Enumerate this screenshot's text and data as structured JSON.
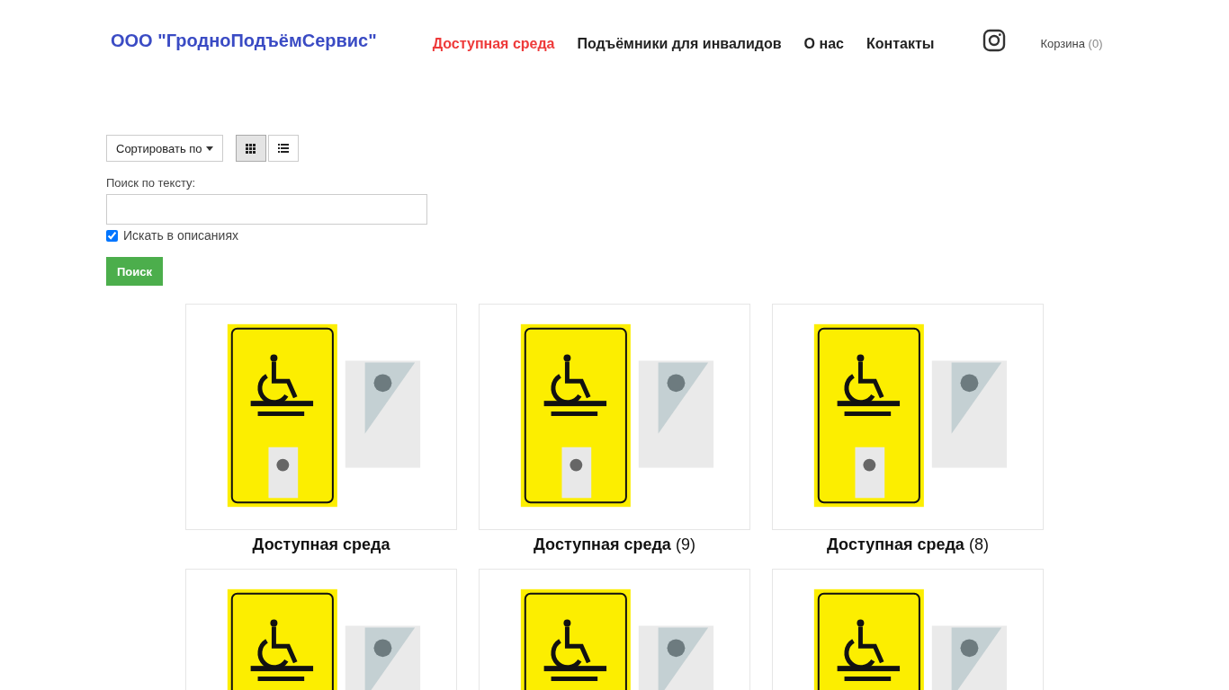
{
  "logo": "ООО \"ГродноПодъёмСервис\"",
  "nav": [
    {
      "label": "Доступная среда",
      "selected": true
    },
    {
      "label": "Подъёмники для инвалидов",
      "selected": false
    },
    {
      "label": "О нас",
      "selected": false
    },
    {
      "label": "Контакты",
      "selected": false
    }
  ],
  "cart": {
    "label": "Корзина",
    "count": "(0)"
  },
  "toolbar": {
    "sort": "Сортировать по",
    "views": [
      {
        "kind": "grid",
        "selected": true
      },
      {
        "kind": "list",
        "selected": false
      }
    ]
  },
  "search": {
    "label": "Поиск по тексту:",
    "in_descriptions": {
      "label": "Искать в описаниях",
      "checked": true
    },
    "button": "Поиск"
  },
  "products": [
    {
      "kind": "captioned",
      "title": "Доступная среда"
    },
    {
      "kind": "captioned",
      "title": "Доступная среда",
      "count": "(9)"
    },
    {
      "kind": "captioned",
      "title": "Доступная среда",
      "count": "(8)"
    },
    {
      "kind": "cut_off"
    },
    {
      "kind": "cut_off"
    },
    {
      "kind": "cut_off"
    }
  ]
}
